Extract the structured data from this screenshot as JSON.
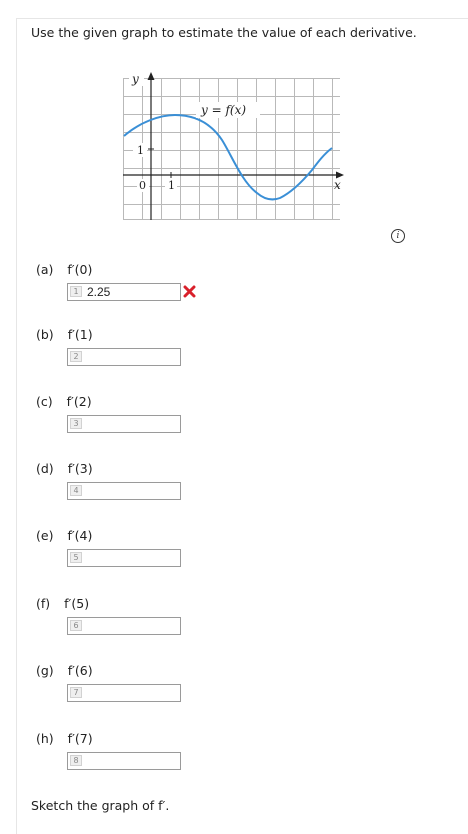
{
  "prompt": "Use the given graph to estimate the value of each derivative.",
  "graph": {
    "y_label": "y",
    "x_label": "x",
    "curve_label": "y = f(x)",
    "tick_y_1": "1",
    "tick_x_0": "0",
    "tick_x_1": "1",
    "curve_color": "#3a8fd6"
  },
  "parts": [
    {
      "label": "(a)",
      "fn": "f′(0)",
      "num": "1",
      "value": "2.25",
      "status": "incorrect"
    },
    {
      "label": "(b)",
      "fn": "f′(1)",
      "num": "2",
      "value": ""
    },
    {
      "label": "(c)",
      "fn": "f′(2)",
      "num": "3",
      "value": ""
    },
    {
      "label": "(d)",
      "fn": "f′(3)",
      "num": "4",
      "value": ""
    },
    {
      "label": "(e)",
      "fn": "f′(4)",
      "num": "5",
      "value": ""
    },
    {
      "label": "(f)",
      "fn": "f′(5)",
      "num": "6",
      "value": ""
    },
    {
      "label": "(g)",
      "fn": "f′(6)",
      "num": "7",
      "value": ""
    },
    {
      "label": "(h)",
      "fn": "f′(7)",
      "num": "8",
      "value": ""
    }
  ],
  "sketch": "Sketch the graph of f′.",
  "colors": {
    "error": "#d9202b",
    "accent": "#3a8fd6"
  }
}
